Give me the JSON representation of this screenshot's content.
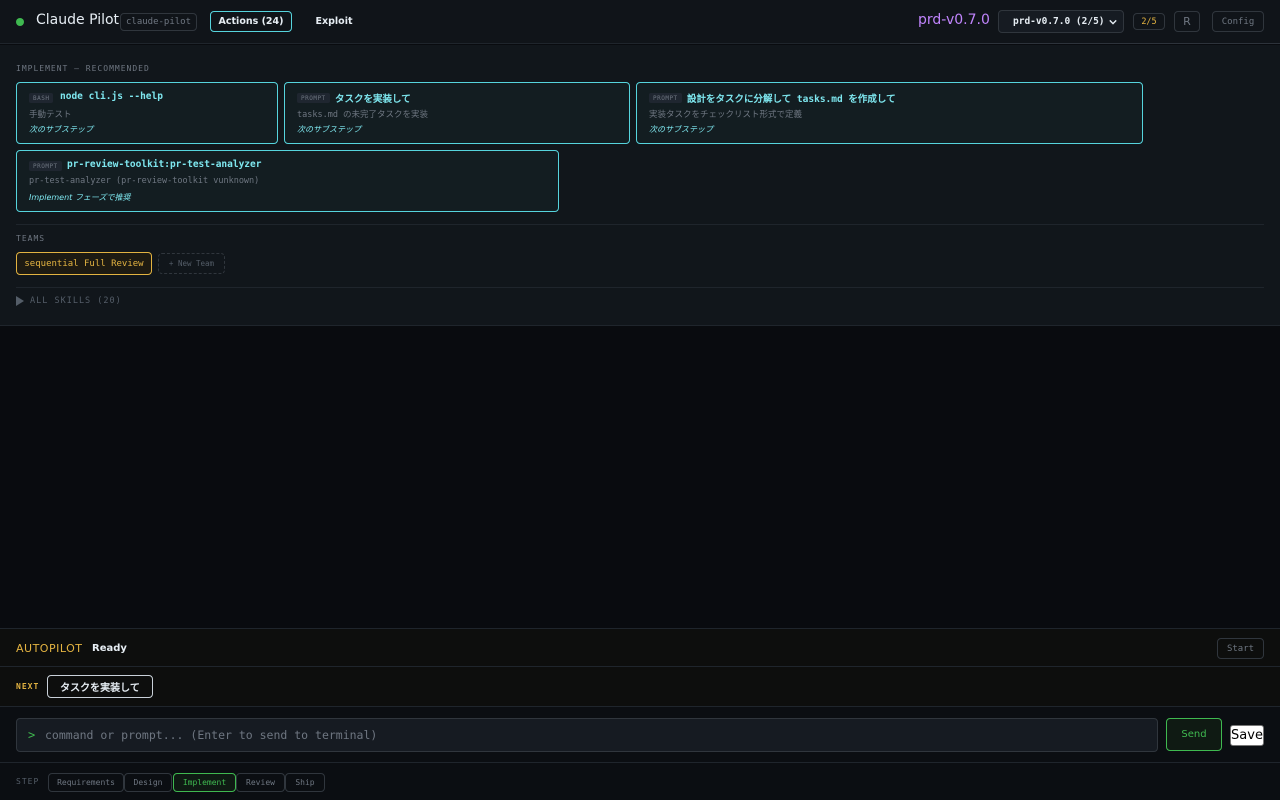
{
  "header": {
    "title": "Claude Pilot",
    "repo_chip": "claude-pilot",
    "tabs": [
      {
        "label": "Actions (24)",
        "active": true
      },
      {
        "label": "Exploit",
        "active": false
      }
    ],
    "version": "prd-v0.7.0",
    "version_select": "prd-v0.7.0 (2/5)",
    "progress": "2/5",
    "r_button": "R",
    "config_button": "Config",
    "status_color": "#3fb950",
    "accent": "#56d4dd",
    "version_color": "#c084fc"
  },
  "implement": {
    "label": "IMPLEMENT — RECOMMENDED",
    "cards": [
      {
        "kind": "BASH",
        "title": "node cli.js --help",
        "desc": "手動テスト",
        "hint": "次のサブステップ"
      },
      {
        "kind": "PROMPT",
        "title": "タスクを実装して",
        "desc": "tasks.md の未完了タスクを実装",
        "hint": "次のサブステップ"
      },
      {
        "kind": "PROMPT",
        "title": "設計をタスクに分解して tasks.md を作成して",
        "desc": "実装タスクをチェックリスト形式で定義",
        "hint": "次のサブステップ"
      },
      {
        "kind": "PROMPT",
        "title": "pr-review-toolkit:pr-test-analyzer",
        "desc": "pr-test-analyzer (pr-review-toolkit vunknown)",
        "hint": "Implement フェーズで推奨"
      }
    ]
  },
  "teams": {
    "label": "TEAMS",
    "team_button": "sequential Full Review",
    "new_team": "+ New Team"
  },
  "skills": {
    "label": "ALL SKILLS (20)",
    "icon": "triangle-right-icon"
  },
  "autopilot": {
    "label": "AUTOPILOT",
    "status": "Ready",
    "start_button": "Start"
  },
  "next": {
    "label": "NEXT",
    "button": "タスクを実装して"
  },
  "command": {
    "prompt_symbol": ">",
    "placeholder": "command or prompt... (Enter to send to terminal)",
    "send_button": "Send",
    "save_button": "Save"
  },
  "steps": {
    "label": "STEP",
    "items": [
      {
        "label": "Requirements",
        "active": false
      },
      {
        "label": "Design",
        "active": false
      },
      {
        "label": "Implement",
        "active": true
      },
      {
        "label": "Review",
        "active": false
      },
      {
        "label": "Ship",
        "active": false
      }
    ]
  }
}
